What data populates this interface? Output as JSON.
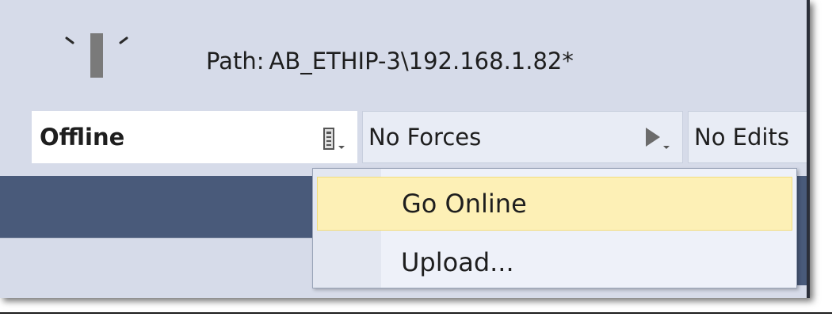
{
  "status": {
    "icon": "key-switch-icon",
    "path_label": "Path:",
    "path_value": "AB_ETHIP-3\\192.168.1.82*"
  },
  "toolbar": {
    "mode_label": "Offline",
    "mode_icon": "controller-dropdown-icon",
    "forces_label": "No Forces",
    "forces_icon": "forces-arrow-dropdown-icon",
    "edits_label": "No Edits"
  },
  "menu": {
    "items": [
      {
        "label": "Go Online",
        "highlighted": true
      },
      {
        "label": "Upload...",
        "highlighted": false
      }
    ]
  },
  "colors": {
    "panel": "#d6dbe9",
    "dark_row": "#495a7a",
    "menu_highlight": "#fdf0b6"
  }
}
